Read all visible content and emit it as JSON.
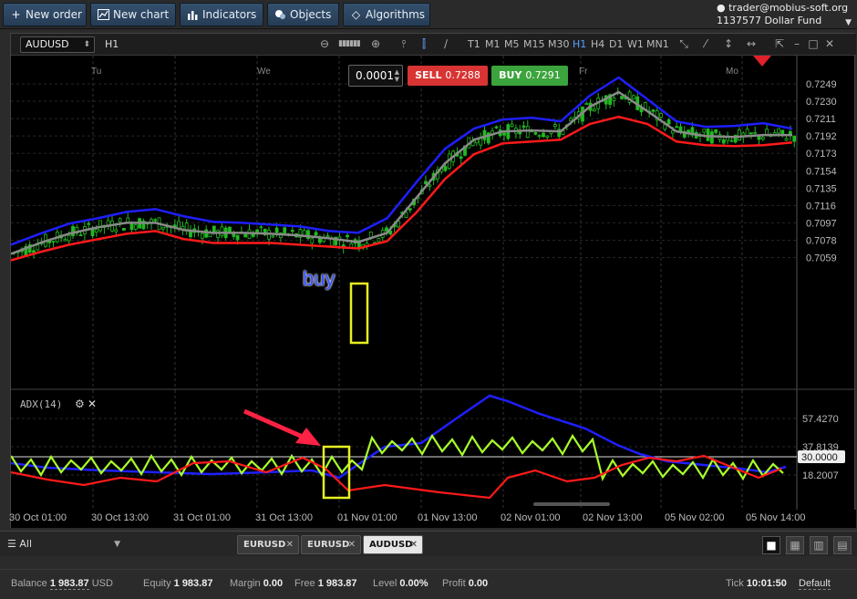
{
  "toolbar": {
    "buttons": [
      {
        "label": "New order",
        "icon": "plus-icon"
      },
      {
        "label": "New chart",
        "icon": "chart-icon"
      },
      {
        "label": "Indicators",
        "icon": "bars-icon"
      },
      {
        "label": "Objects",
        "icon": "objects-icon"
      },
      {
        "label": "Algorithms",
        "icon": "diamond-icon"
      }
    ]
  },
  "account": {
    "email": "trader@mobius-soft.org",
    "id": "1137577",
    "name": "Dollar Fund"
  },
  "chart": {
    "symbol": "AUDUSD",
    "timeframe": "H1",
    "timeframes": [
      "T1",
      "M1",
      "M5",
      "M15",
      "M30",
      "H1",
      "H4",
      "D1",
      "W1",
      "MN1"
    ],
    "active_timeframe": "H1",
    "quantity": "0.0001",
    "sell_label": "SELL",
    "sell_price": "0.7288",
    "buy_label": "BUY",
    "buy_price": "0.7291",
    "day_labels": [
      "Tu",
      "We",
      "Fr",
      "Mo"
    ],
    "price_ticks": [
      "0.7249",
      "0.7230",
      "0.7211",
      "0.7192",
      "0.7173",
      "0.7154",
      "0.7135",
      "0.7116",
      "0.7097",
      "0.7078",
      "0.7059"
    ],
    "adx_title": "ADX(14)",
    "adx_ticks": [
      "57.4270",
      "37.8139",
      "18.2007"
    ],
    "adx_level": "30.0000",
    "time_labels": [
      "30 Oct 01:00",
      "30 Oct 13:00",
      "31 Oct 01:00",
      "31 Oct 13:00",
      "01 Nov 01:00",
      "01 Nov 13:00",
      "02 Nov 01:00",
      "02 Nov 13:00",
      "05 Nov 02:00",
      "05 Nov 14:00"
    ],
    "annotation": "buy",
    "colors": {
      "upper_band": "#1f1fff",
      "middle_band": "#8a8a8a",
      "lower_band": "#ff1a1a",
      "candle": "#22b822",
      "adx_main": "#1f1fff",
      "adx_plus": "#a8ff2a",
      "adx_minus": "#ff1a1a",
      "highlight": "#e8f020",
      "arrow": "#ff2244"
    }
  },
  "chart_data": {
    "type": "line",
    "series": [
      {
        "values": [
          0.7073,
          0.7085,
          0.7096,
          0.7102,
          0.7109,
          0.7112,
          0.7104,
          0.7098,
          0.7097,
          0.7095,
          0.7093,
          0.7088,
          0.7086,
          0.7102,
          0.7141,
          0.7178,
          0.72,
          0.721,
          0.7212,
          0.7208,
          0.7236,
          0.7256,
          0.7232,
          0.7208,
          0.7202,
          0.7203,
          0.7206,
          0.72
        ]
      },
      {
        "values": [
          0.7063,
          0.7075,
          0.7085,
          0.7092,
          0.7097,
          0.7097,
          0.7089,
          0.7086,
          0.7086,
          0.7085,
          0.7083,
          0.708,
          0.7076,
          0.7086,
          0.7124,
          0.7162,
          0.7188,
          0.7197,
          0.7198,
          0.7197,
          0.7224,
          0.724,
          0.7219,
          0.7197,
          0.7192,
          0.7191,
          0.7193,
          0.7193
        ]
      },
      {
        "values": [
          0.7056,
          0.7065,
          0.7073,
          0.7079,
          0.7085,
          0.7088,
          0.7079,
          0.7075,
          0.7075,
          0.7075,
          0.7073,
          0.7071,
          0.7069,
          0.7077,
          0.7108,
          0.7145,
          0.7172,
          0.7184,
          0.7186,
          0.7188,
          0.7205,
          0.7213,
          0.7205,
          0.7186,
          0.7182,
          0.7181,
          0.7182,
          0.7185
        ]
      }
    ]
  },
  "tabs": {
    "filter": "All",
    "symbols": [
      "EURUSD",
      "EURUSD",
      "AUDUSD"
    ],
    "active_index": 2
  },
  "status": {
    "balance_label": "Balance",
    "balance": "1 983.87",
    "currency": "USD",
    "equity_label": "Equity",
    "equity": "1 983.87",
    "margin_label": "Margin",
    "margin": "0.00",
    "free_label": "Free",
    "free": "1 983.87",
    "level_label": "Level",
    "level": "0.00%",
    "profit_label": "Profit",
    "profit": "0.00",
    "tick_label": "Tick",
    "tick_time": "10:01:50",
    "tick_mode": "Default"
  }
}
